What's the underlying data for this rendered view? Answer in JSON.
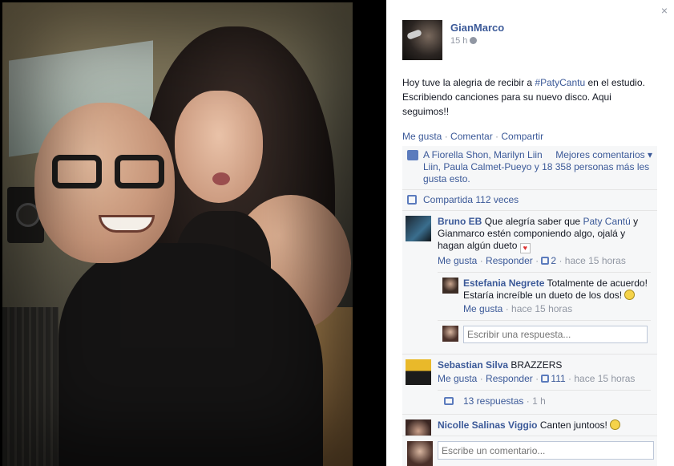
{
  "photo": {
    "description_icon": "photo-viewer"
  },
  "post": {
    "author": "GianMarco",
    "time": "15 h",
    "text_before": "Hoy tuve la alegria de recibir a ",
    "hashtag": "#PatyCantu",
    "text_after": " en el estudio. Escribiendo canciones para su nuevo disco. Aqui seguimos!!",
    "actions": {
      "like": "Me gusta",
      "comment": "Comentar",
      "share": "Compartir",
      "sep": " · "
    }
  },
  "likes": {
    "text": "A Fiorella Shon, Marilyn Liin Liin, Paula Calmet-Pueyo y 18 358 personas más les gusta esto.",
    "sort_label": "Mejores comentarios ▾"
  },
  "shares": {
    "text": "Compartida 112 veces"
  },
  "comments": [
    {
      "name": "Bruno EB",
      "text_before": "Que alegría saber que ",
      "mention": "Paty Cantú",
      "text_after": " y Gianmarco estén componiendo algo, ojalá y hagan algún dueto ",
      "like": "Me gusta",
      "respond": "Responder",
      "likes_count": "2",
      "time": "hace 15 horas",
      "reply": {
        "name": "Estefania Negrete",
        "text": "Totalmente de acuerdo! Estaría increíble un dueto de los dos! ",
        "like": "Me gusta",
        "time": "hace 15 horas"
      },
      "reply_placeholder": "Escribir una respuesta..."
    },
    {
      "name": "Sebastian Silva",
      "text": "BRAZZERS",
      "like": "Me gusta",
      "respond": "Responder",
      "likes_count": "111",
      "time": "hace 15 horas",
      "more_replies": "13 respuestas",
      "more_time": "1 h"
    },
    {
      "name": "Nicolle Salinas Viggio",
      "text": "Canten juntoos! "
    }
  ],
  "composer": {
    "placeholder": "Escribe un comentario..."
  },
  "close_glyph": "×",
  "colors": {
    "link": "#3b5998",
    "muted": "#9197a3",
    "panel_bg": "#f6f7f8"
  }
}
